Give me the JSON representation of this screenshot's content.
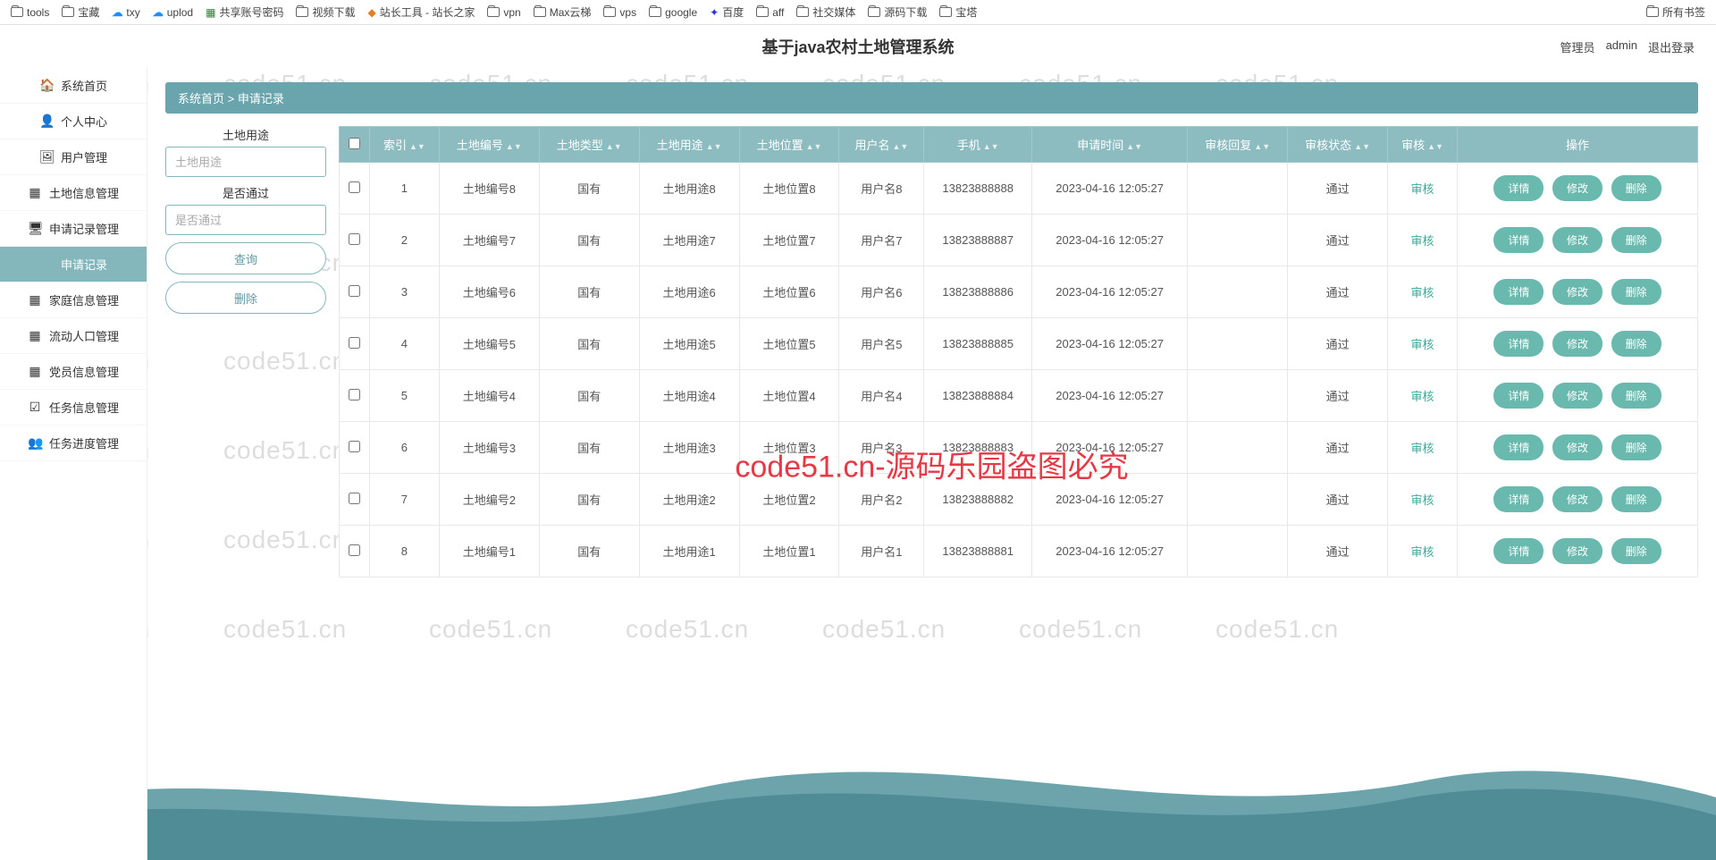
{
  "bookmarks": {
    "left": [
      {
        "name": "tools",
        "icon": "folder"
      },
      {
        "name": "宝藏",
        "icon": "folder"
      },
      {
        "name": "txy",
        "icon": "cloud"
      },
      {
        "name": "uplod",
        "icon": "cloud"
      },
      {
        "name": "共享账号密码",
        "icon": "green"
      },
      {
        "name": "视频下载",
        "icon": "folder"
      },
      {
        "name": "站长工具 - 站长之家",
        "icon": "orange"
      },
      {
        "name": "vpn",
        "icon": "folder"
      },
      {
        "name": "Max云梯",
        "icon": "folder"
      },
      {
        "name": "vps",
        "icon": "folder"
      },
      {
        "name": "google",
        "icon": "folder"
      },
      {
        "name": "百度",
        "icon": "baidu"
      },
      {
        "name": "aff",
        "icon": "folder"
      },
      {
        "name": "社交媒体",
        "icon": "folder"
      },
      {
        "name": "源码下载",
        "icon": "folder"
      },
      {
        "name": "宝塔",
        "icon": "folder"
      }
    ],
    "right": {
      "name": "所有书签",
      "icon": "folder"
    }
  },
  "header": {
    "title": "基于java农村土地管理系统",
    "user_role": "管理员",
    "user_name": "admin",
    "logout": "退出登录"
  },
  "sidebar": {
    "items": [
      {
        "label": "系统首页",
        "icon": "🏠"
      },
      {
        "label": "个人中心",
        "icon": "👤"
      },
      {
        "label": "用户管理",
        "icon": "🖼"
      },
      {
        "label": "土地信息管理",
        "icon": "▦"
      },
      {
        "label": "申请记录管理",
        "icon": "🖥"
      },
      {
        "label": "申请记录",
        "icon": "",
        "active": true
      },
      {
        "label": "家庭信息管理",
        "icon": "▦"
      },
      {
        "label": "流动人口管理",
        "icon": "▦"
      },
      {
        "label": "党员信息管理",
        "icon": "▦"
      },
      {
        "label": "任务信息管理",
        "icon": "☑"
      },
      {
        "label": "任务进度管理",
        "icon": "👥"
      }
    ]
  },
  "breadcrumb": {
    "text": "系统首页 > 申请记录"
  },
  "filter": {
    "label1": "土地用途",
    "placeholder1": "土地用途",
    "label2": "是否通过",
    "placeholder2": "是否通过",
    "query_btn": "查询",
    "delete_btn": "删除"
  },
  "table": {
    "headers": [
      "索引",
      "土地编号",
      "土地类型",
      "土地用途",
      "土地位置",
      "用户名",
      "手机",
      "申请时间",
      "审核回复",
      "审核状态",
      "审核",
      "操作"
    ],
    "rows": [
      {
        "idx": "1",
        "code": "土地编号8",
        "type": "国有",
        "use": "土地用途8",
        "loc": "土地位置8",
        "user": "用户名8",
        "phone": "13823888888",
        "time": "2023-04-16 12:05:27",
        "reply": "",
        "status": "通过",
        "audit": "审核"
      },
      {
        "idx": "2",
        "code": "土地编号7",
        "type": "国有",
        "use": "土地用途7",
        "loc": "土地位置7",
        "user": "用户名7",
        "phone": "13823888887",
        "time": "2023-04-16 12:05:27",
        "reply": "",
        "status": "通过",
        "audit": "审核"
      },
      {
        "idx": "3",
        "code": "土地编号6",
        "type": "国有",
        "use": "土地用途6",
        "loc": "土地位置6",
        "user": "用户名6",
        "phone": "13823888886",
        "time": "2023-04-16 12:05:27",
        "reply": "",
        "status": "通过",
        "audit": "审核"
      },
      {
        "idx": "4",
        "code": "土地编号5",
        "type": "国有",
        "use": "土地用途5",
        "loc": "土地位置5",
        "user": "用户名5",
        "phone": "13823888885",
        "time": "2023-04-16 12:05:27",
        "reply": "",
        "status": "通过",
        "audit": "审核"
      },
      {
        "idx": "5",
        "code": "土地编号4",
        "type": "国有",
        "use": "土地用途4",
        "loc": "土地位置4",
        "user": "用户名4",
        "phone": "13823888884",
        "time": "2023-04-16 12:05:27",
        "reply": "",
        "status": "通过",
        "audit": "审核"
      },
      {
        "idx": "6",
        "code": "土地编号3",
        "type": "国有",
        "use": "土地用途3",
        "loc": "土地位置3",
        "user": "用户名3",
        "phone": "13823888883",
        "time": "2023-04-16 12:05:27",
        "reply": "",
        "status": "通过",
        "audit": "审核"
      },
      {
        "idx": "7",
        "code": "土地编号2",
        "type": "国有",
        "use": "土地用途2",
        "loc": "土地位置2",
        "user": "用户名2",
        "phone": "13823888882",
        "time": "2023-04-16 12:05:27",
        "reply": "",
        "status": "通过",
        "audit": "审核"
      },
      {
        "idx": "8",
        "code": "土地编号1",
        "type": "国有",
        "use": "土地用途1",
        "loc": "土地位置1",
        "user": "用户名1",
        "phone": "13823888881",
        "time": "2023-04-16 12:05:27",
        "reply": "",
        "status": "通过",
        "audit": "审核"
      }
    ],
    "op_detail": "详情",
    "op_edit": "修改",
    "op_delete": "删除"
  },
  "watermark_text": "code51.cn",
  "big_watermark": "code51.cn-源码乐园盗图必究"
}
